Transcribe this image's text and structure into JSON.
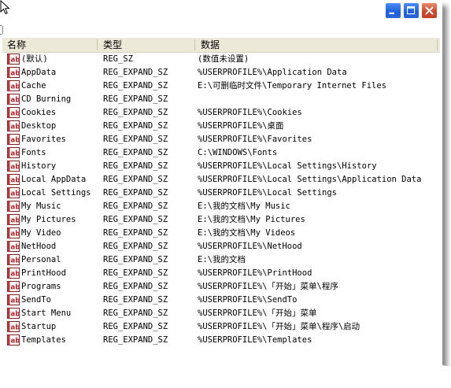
{
  "window": {
    "controls": {
      "minimize_icon": "minimize-icon",
      "maximize_icon": "maximize-icon",
      "close_icon": "close-icon"
    },
    "accent_color": "#2a66d9",
    "close_color": "#c9462c"
  },
  "columns": {
    "name": "名称",
    "type": "类型",
    "data": "数据"
  },
  "rows": [
    {
      "name": "(默认)",
      "type": "REG_SZ",
      "data": "(数值未设置)"
    },
    {
      "name": "AppData",
      "type": "REG_EXPAND_SZ",
      "data": "%USERPROFILE%\\Application Data"
    },
    {
      "name": "Cache",
      "type": "REG_EXPAND_SZ",
      "data": "E:\\可删临时文件\\Temporary Internet Files"
    },
    {
      "name": "CD Burning",
      "type": "REG_EXPAND_SZ",
      "data": ""
    },
    {
      "name": "Cookies",
      "type": "REG_EXPAND_SZ",
      "data": "%USERPROFILE%\\Cookies"
    },
    {
      "name": "Desktop",
      "type": "REG_EXPAND_SZ",
      "data": "%USERPROFILE%\\桌面"
    },
    {
      "name": "Favorites",
      "type": "REG_EXPAND_SZ",
      "data": "%USERPROFILE%\\Favorites"
    },
    {
      "name": "Fonts",
      "type": "REG_EXPAND_SZ",
      "data": "C:\\WINDOWS\\Fonts"
    },
    {
      "name": "History",
      "type": "REG_EXPAND_SZ",
      "data": "%USERPROFILE%\\Local Settings\\History"
    },
    {
      "name": "Local AppData",
      "type": "REG_EXPAND_SZ",
      "data": "%USERPROFILE%\\Local Settings\\Application Data"
    },
    {
      "name": "Local Settings",
      "type": "REG_EXPAND_SZ",
      "data": "%USERPROFILE%\\Local Settings"
    },
    {
      "name": "My Music",
      "type": "REG_EXPAND_SZ",
      "data": "E:\\我的文档\\My Music"
    },
    {
      "name": "My Pictures",
      "type": "REG_EXPAND_SZ",
      "data": "E:\\我的文档\\My Pictures"
    },
    {
      "name": "My Video",
      "type": "REG_EXPAND_SZ",
      "data": "E:\\我的文档\\My Videos"
    },
    {
      "name": "NetHood",
      "type": "REG_EXPAND_SZ",
      "data": "%USERPROFILE%\\NetHood"
    },
    {
      "name": "Personal",
      "type": "REG_EXPAND_SZ",
      "data": "E:\\我的文档"
    },
    {
      "name": "PrintHood",
      "type": "REG_EXPAND_SZ",
      "data": "%USERPROFILE%\\PrintHood"
    },
    {
      "name": "Programs",
      "type": "REG_EXPAND_SZ",
      "data": "%USERPROFILE%\\「开始」菜单\\程序"
    },
    {
      "name": "SendTo",
      "type": "REG_EXPAND_SZ",
      "data": "%USERPROFILE%\\SendTo"
    },
    {
      "name": "Start Menu",
      "type": "REG_EXPAND_SZ",
      "data": "%USERPROFILE%\\「开始」菜单"
    },
    {
      "name": "Startup",
      "type": "REG_EXPAND_SZ",
      "data": "%USERPROFILE%\\「开始」菜单\\程序\\启动"
    },
    {
      "name": "Templates",
      "type": "REG_EXPAND_SZ",
      "data": "%USERPROFILE%\\Templates"
    }
  ],
  "row_icon": "reg-string-value-icon",
  "icon_label": "ab"
}
